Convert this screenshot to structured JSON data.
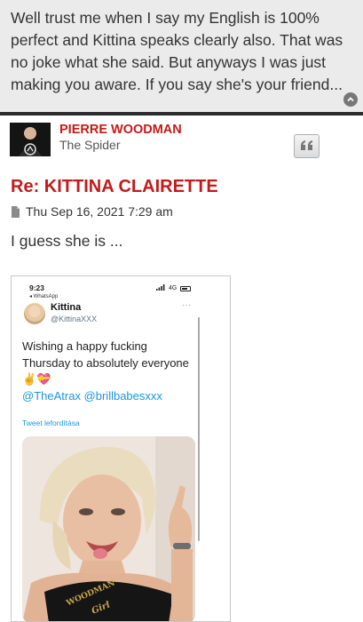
{
  "quote": {
    "text": "Well trust me when I say my English is 100% perfect and Kittina speaks clearly also. That was no joke what she said. But anyways I was just making you aware. If you say she's your friend...",
    "expand_icon": "chevron-up-icon"
  },
  "post": {
    "author": "PIERRE WOODMAN",
    "rank": "The Spider",
    "quote_button_icon": "quote-icon",
    "title": "Re: KITTINA CLAIRETTE",
    "timestamp": "Thu Sep 16, 2021 7:29 am",
    "timestamp_icon": "file-icon",
    "body": "I guess she is ..."
  },
  "embedded_screenshot": {
    "status_time": "9:23",
    "back_label": "◂ WhatsApp",
    "network": "4G",
    "tweet_author_name": "Kittina",
    "tweet_author_handle": "@KittinaXXX",
    "more_label": "···",
    "tweet_text": "Wishing a happy fucking Thursday to absolutely everyone ✌️💝",
    "tweet_mentions": "@TheAtrax @brillbabesxxx",
    "translate_link": "Tweet lefordítása",
    "photo_caption_line1": "WOODMAN",
    "photo_caption_line2": "Girl"
  },
  "colors": {
    "accent_red": "#c41a1a",
    "quote_bg": "#ebebeb",
    "twitter_blue": "#1b95e0"
  }
}
